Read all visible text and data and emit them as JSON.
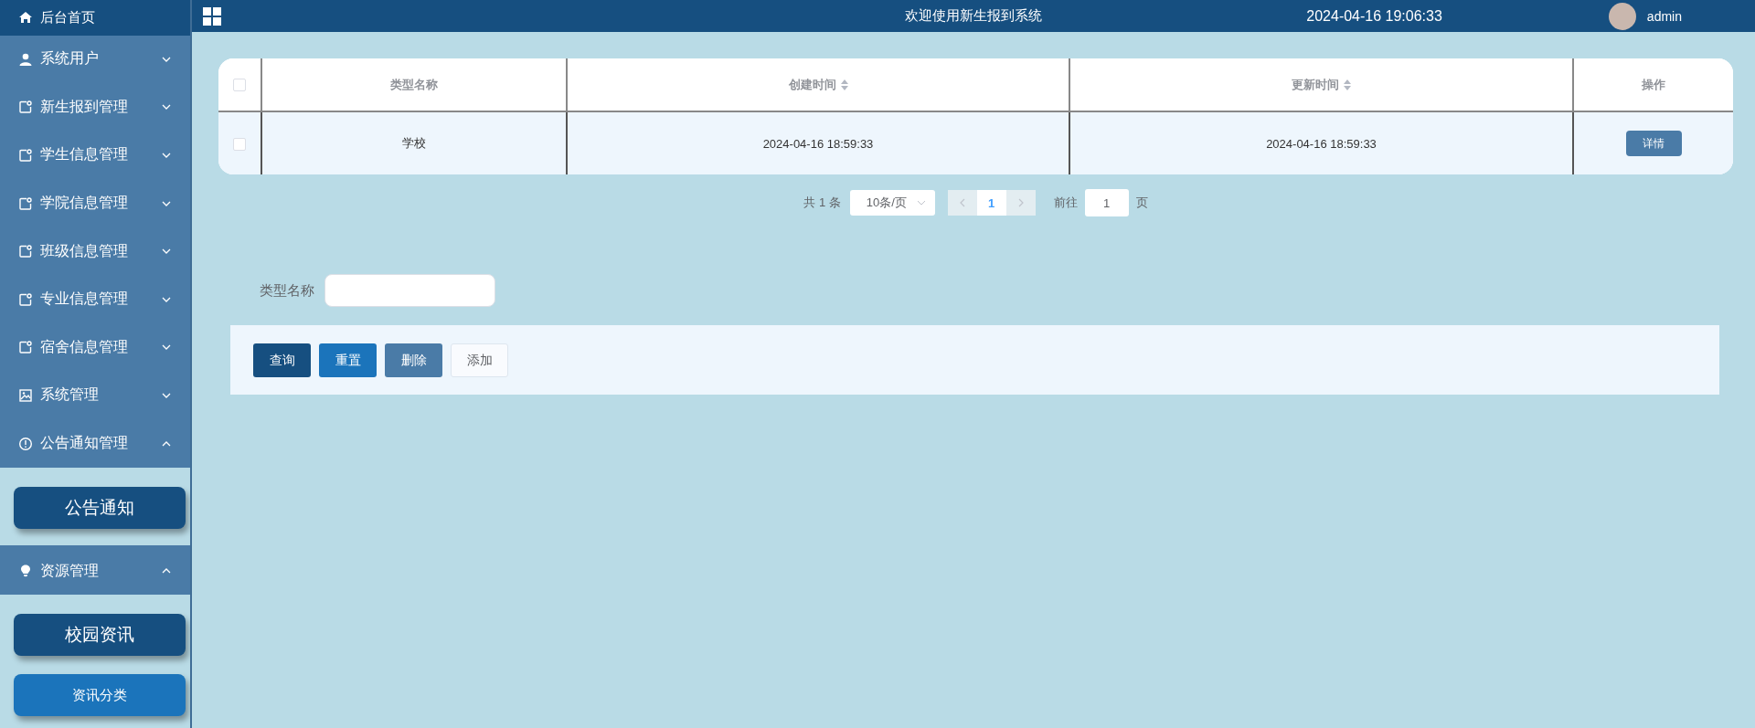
{
  "sidebar": {
    "items": [
      {
        "label": "后台首页",
        "kind": "link"
      },
      {
        "label": "系统用户",
        "kind": "menu",
        "expanded": false
      },
      {
        "label": "新生报到管理",
        "kind": "menu",
        "expanded": false
      },
      {
        "label": "学生信息管理",
        "kind": "menu",
        "expanded": false
      },
      {
        "label": "学院信息管理",
        "kind": "menu",
        "expanded": false
      },
      {
        "label": "班级信息管理",
        "kind": "menu",
        "expanded": false
      },
      {
        "label": "专业信息管理",
        "kind": "menu",
        "expanded": false
      },
      {
        "label": "宿舍信息管理",
        "kind": "menu",
        "expanded": false
      },
      {
        "label": "系统管理",
        "kind": "menu",
        "expanded": false
      },
      {
        "label": "公告通知管理",
        "kind": "menu",
        "expanded": true,
        "children": [
          {
            "label": "公告通知",
            "kind": "group",
            "selected": false
          }
        ]
      },
      {
        "label": "资源管理",
        "kind": "menu",
        "expanded": true,
        "children": [
          {
            "label": "校园资讯",
            "kind": "group",
            "selected": false
          },
          {
            "label": "资讯分类",
            "kind": "item",
            "selected": true
          }
        ]
      }
    ]
  },
  "header": {
    "title": "欢迎使用新生报到系统",
    "datetime": "2024-04-16 19:06:33",
    "user": "admin"
  },
  "table": {
    "select_all": {
      "checked": false
    },
    "columns": [
      {
        "label": "类型名称",
        "sortable": false
      },
      {
        "label": "创建时间",
        "sortable": true
      },
      {
        "label": "更新时间",
        "sortable": true
      },
      {
        "label": "操作",
        "sortable": false
      }
    ],
    "rows": [
      {
        "checked": false,
        "cells": [
          "学校",
          "2024-04-16 18:59:33",
          "2024-04-16 18:59:33"
        ],
        "action": "详情"
      }
    ]
  },
  "pagination": {
    "total": "共 1 条",
    "page_size": "10条/页",
    "prev_disabled": true,
    "next_disabled": true,
    "pages": [
      {
        "label": "1",
        "selected": true
      }
    ],
    "goto_label": "前往",
    "goto_value": "1",
    "goto_suffix": "页"
  },
  "search": {
    "label": "类型名称",
    "buttons": [
      {
        "label": "查询",
        "kind": "query"
      },
      {
        "label": "重置",
        "kind": "reset"
      },
      {
        "label": "删除",
        "kind": "delete"
      },
      {
        "label": "添加",
        "kind": "add"
      }
    ]
  }
}
